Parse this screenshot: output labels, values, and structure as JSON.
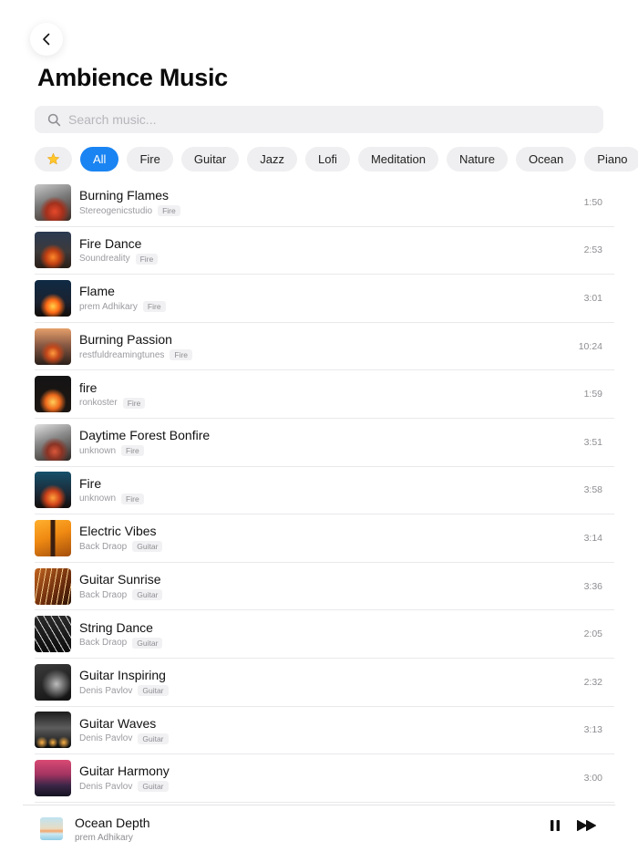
{
  "header": {
    "title": "Ambience Music",
    "back_icon": "chevron-left-icon"
  },
  "search": {
    "placeholder": "Search music...",
    "value": "",
    "icon": "search-icon"
  },
  "filters": {
    "favorites_icon": "star-icon",
    "selected": "All",
    "items": [
      "All",
      "Fire",
      "Guitar",
      "Jazz",
      "Lofi",
      "Meditation",
      "Nature",
      "Ocean",
      "Piano"
    ]
  },
  "tracks": [
    {
      "title": "Burning Flames",
      "artist": "Stereogenicstudio",
      "tag": "Fire",
      "duration": "1:50"
    },
    {
      "title": "Fire Dance",
      "artist": "Soundreality",
      "tag": "Fire",
      "duration": "2:53"
    },
    {
      "title": "Flame",
      "artist": "prem Adhikary",
      "tag": "Fire",
      "duration": "3:01"
    },
    {
      "title": "Burning Passion",
      "artist": "restfuldreamingtunes",
      "tag": "Fire",
      "duration": "10:24"
    },
    {
      "title": "fire",
      "artist": "ronkoster",
      "tag": "Fire",
      "duration": "1:59"
    },
    {
      "title": "Daytime Forest Bonfire",
      "artist": "unknown",
      "tag": "Fire",
      "duration": "3:51"
    },
    {
      "title": "Fire",
      "artist": "unknown",
      "tag": "Fire",
      "duration": "3:58"
    },
    {
      "title": "Electric Vibes",
      "artist": "Back Draop",
      "tag": "Guitar",
      "duration": "3:14"
    },
    {
      "title": "Guitar Sunrise",
      "artist": "Back Draop",
      "tag": "Guitar",
      "duration": "3:36"
    },
    {
      "title": "String Dance",
      "artist": "Back Draop",
      "tag": "Guitar",
      "duration": "2:05"
    },
    {
      "title": "Guitar Inspiring",
      "artist": "Denis Pavlov",
      "tag": "Guitar",
      "duration": "2:32"
    },
    {
      "title": " Guitar Waves",
      "artist": "Denis Pavlov",
      "tag": "Guitar",
      "duration": "3:13"
    },
    {
      "title": "Guitar Harmony",
      "artist": "Denis Pavlov",
      "tag": "Guitar",
      "duration": "3:00"
    }
  ],
  "now_playing": {
    "title": "Ocean Depth",
    "artist": "prem Adhikary",
    "pause_icon": "pause-icon",
    "next_icon": "fast-forward-icon"
  },
  "colors": {
    "accent": "#1a84f2",
    "chip_bg": "#efeff1",
    "search_bg": "#f0f0f2"
  }
}
